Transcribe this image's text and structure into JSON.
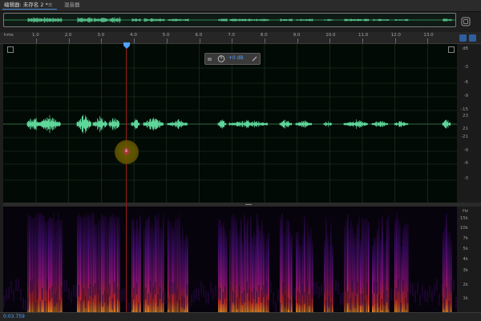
{
  "tabs": {
    "active_label": "编辑器: 未存名 2 *",
    "menu_glyph": "≡",
    "second_label": "混音器"
  },
  "ruler": {
    "unit": "hms",
    "ticks": [
      "1.0",
      "2.0",
      "3.0",
      "4.0",
      "5.0",
      "6.0",
      "7.0",
      "8.0",
      "9.0",
      "10.0",
      "11.0",
      "12.0",
      "13.0"
    ]
  },
  "waveform": {
    "db_unit": "dB",
    "db_ticks": [
      "-3",
      "-6",
      "-9",
      "-15",
      "-21",
      "-9",
      "-6",
      "-3"
    ],
    "db_center_upper": "23",
    "db_center_lower": "21",
    "hud_value": "+0 dB",
    "colors": {
      "wave": "#5fd69a",
      "grid": "#1f3a2a",
      "center": "#2f6b45"
    }
  },
  "spectrum": {
    "hz_unit": "Hz",
    "hz_ticks": [
      "15k",
      "10k",
      "7k",
      "5k",
      "4k",
      "3k",
      "2k",
      "1k"
    ]
  },
  "transport": {
    "time": "0:03.759"
  },
  "icons": {
    "overview_zoom": "zoom-full-icon",
    "playhead": "playhead-marker-icon",
    "pan_knob": "pan-knob-icon"
  }
}
